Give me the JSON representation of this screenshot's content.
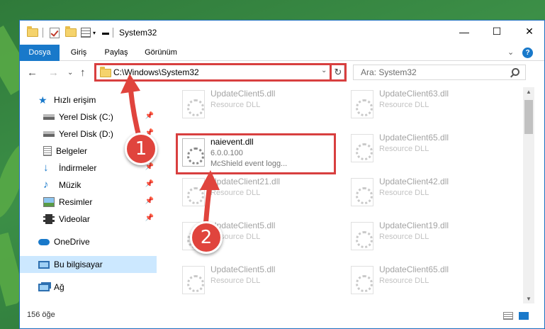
{
  "window": {
    "title": "System32",
    "controls": {
      "minimize": "—",
      "maximize": "☐",
      "close": "✕"
    }
  },
  "ribbon": {
    "tabs": [
      {
        "label": "Dosya"
      },
      {
        "label": "Giriş"
      },
      {
        "label": "Paylaş"
      },
      {
        "label": "Görünüm"
      }
    ],
    "expand": "⌄",
    "help": "?"
  },
  "nav": {
    "back": "←",
    "forward": "→",
    "recent": "⌄",
    "up": "↑",
    "address": "C:\\Windows\\System32",
    "address_dropdown": "⌄",
    "refresh": "↻",
    "search_placeholder": "Ara: System32"
  },
  "sidebar": {
    "items": [
      {
        "label": "Hızlı erişim",
        "icon": "star-icon"
      },
      {
        "label": "Yerel Disk (C:)",
        "icon": "drive-icon",
        "pinned": true
      },
      {
        "label": "Yerel Disk (D:)",
        "icon": "drive-icon",
        "pinned": true
      },
      {
        "label": "Belgeler",
        "icon": "documents-icon",
        "pinned": true
      },
      {
        "label": "İndirmeler",
        "icon": "download-icon",
        "pinned": true
      },
      {
        "label": "Müzik",
        "icon": "music-icon",
        "pinned": true
      },
      {
        "label": "Resimler",
        "icon": "pictures-icon",
        "pinned": true
      },
      {
        "label": "Videolar",
        "icon": "videos-icon",
        "pinned": true
      },
      {
        "label": "OneDrive",
        "icon": "cloud-icon"
      },
      {
        "label": "Bu bilgisayar",
        "icon": "computer-icon",
        "selected": true
      },
      {
        "label": "Ağ",
        "icon": "network-icon"
      }
    ],
    "pin_glyph": "📌"
  },
  "files": {
    "left": [
      {
        "name": "UpdateClient5.dll",
        "type": "Resource DLL"
      },
      {
        "name": "naievent.dll",
        "version": "6.0.0.100",
        "desc": "McShield event logg...",
        "highlighted": true
      },
      {
        "name": "UpdateClient21.dll",
        "type": "Resource DLL"
      },
      {
        "name": "UpdateClient5.dll",
        "type": "Resource DLL"
      },
      {
        "name": "UpdateClient5.dll",
        "type": "Resource DLL"
      }
    ],
    "right": [
      {
        "name": "UpdateClient63.dll",
        "type": "Resource DLL"
      },
      {
        "name": "UpdateClient65.dll",
        "type": "Resource DLL"
      },
      {
        "name": "UpdateClient42.dll",
        "type": "Resource DLL"
      },
      {
        "name": "UpdateClient19.dll",
        "type": "Resource DLL"
      },
      {
        "name": "UpdateClient65.dll",
        "type": "Resource DLL"
      }
    ]
  },
  "status": {
    "count": "156 öğe"
  },
  "callouts": [
    {
      "number": "1"
    },
    {
      "number": "2"
    }
  ],
  "colors": {
    "accent": "#1979ca",
    "highlight_red": "#d83f3f",
    "callout_red": "#e0443d",
    "selected_bg": "#cce8ff"
  }
}
